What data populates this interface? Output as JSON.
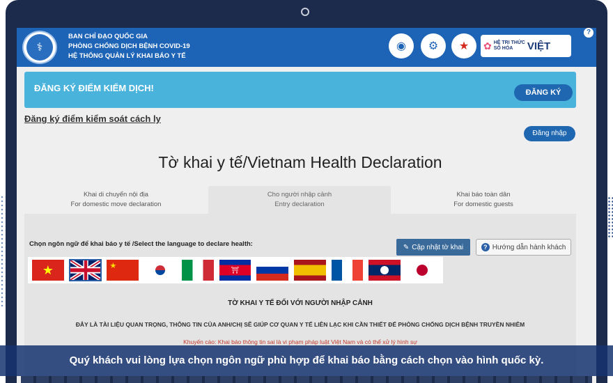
{
  "header": {
    "org_lines": [
      "BAN CHỈ ĐẠO QUỐC GIA",
      "PHÒNG CHỐNG DỊCH BỆNH COVID-19",
      "HỆ THỐNG QUẢN LÝ KHAI BÁO Y TẾ"
    ],
    "brand_small_1": "HỆ TRI THỨC",
    "brand_small_2": "SỐ HÓA",
    "brand_big": "VIỆT",
    "help_icon": "?"
  },
  "banner": {
    "text": "ĐĂNG KÝ ĐIỂM KIỂM DỊCH!",
    "button": "ĐĂNG KÝ"
  },
  "links": {
    "register_quarantine": "Đăng ký điểm kiểm soát cách ly",
    "login": "Đăng nhập"
  },
  "page_title": "Tờ khai y tế/Vietnam Health Declaration",
  "tabs": [
    {
      "line1": "Khai di chuyển nội địa",
      "line2": "For domestic move declaration"
    },
    {
      "line1": "Cho người nhập cảnh",
      "line2": "Entry declaration"
    },
    {
      "line1": "Khai báo toàn dân",
      "line2": "For domestic guests"
    }
  ],
  "active_tab": 1,
  "language": {
    "label": "Chọn ngôn ngữ để khai báo y tế /Select the language to declare health:",
    "update_button": "Cập nhật tờ khai",
    "guide_button": "Hướng dẫn hành khách",
    "flags": [
      "vietnam-flag",
      "uk-flag",
      "china-flag",
      "korea-flag",
      "italy-flag",
      "cambodia-flag",
      "russia-flag",
      "spain-flag",
      "france-flag",
      "laos-flag",
      "japan-flag"
    ],
    "selected": "uk-flag"
  },
  "form": {
    "title": "TỜ KHAI Y TẾ ĐỐI VỚI NGƯỜI NHẬP CẢNH",
    "note": "ĐÂY LÀ TÀI LIỆU QUAN TRỌNG, THÔNG TIN CỦA ANH/CHỊ SẼ GIÚP CƠ QUAN Y TẾ LIÊN LẠC KHI CẦN THIẾT ĐỂ PHÒNG CHỐNG DỊCH BỆNH TRUYỀN NHIỄM",
    "warning": "Khuyến cáo: Khai báo thông tin sai là vi phạm pháp luật Việt Nam và có thể xử lý hình sự"
  },
  "caption": "Quý khách vui lòng lựa chọn ngôn ngữ phù hợp để khai báo bằng cách chọn vào hình quốc kỳ.",
  "colors": {
    "header_blue": "#1e64b6",
    "banner_cyan": "#4ab3dc",
    "button_blue": "#1f67b1",
    "laptop_frame": "#1c2b4c",
    "warning_red": "#c0392b"
  }
}
